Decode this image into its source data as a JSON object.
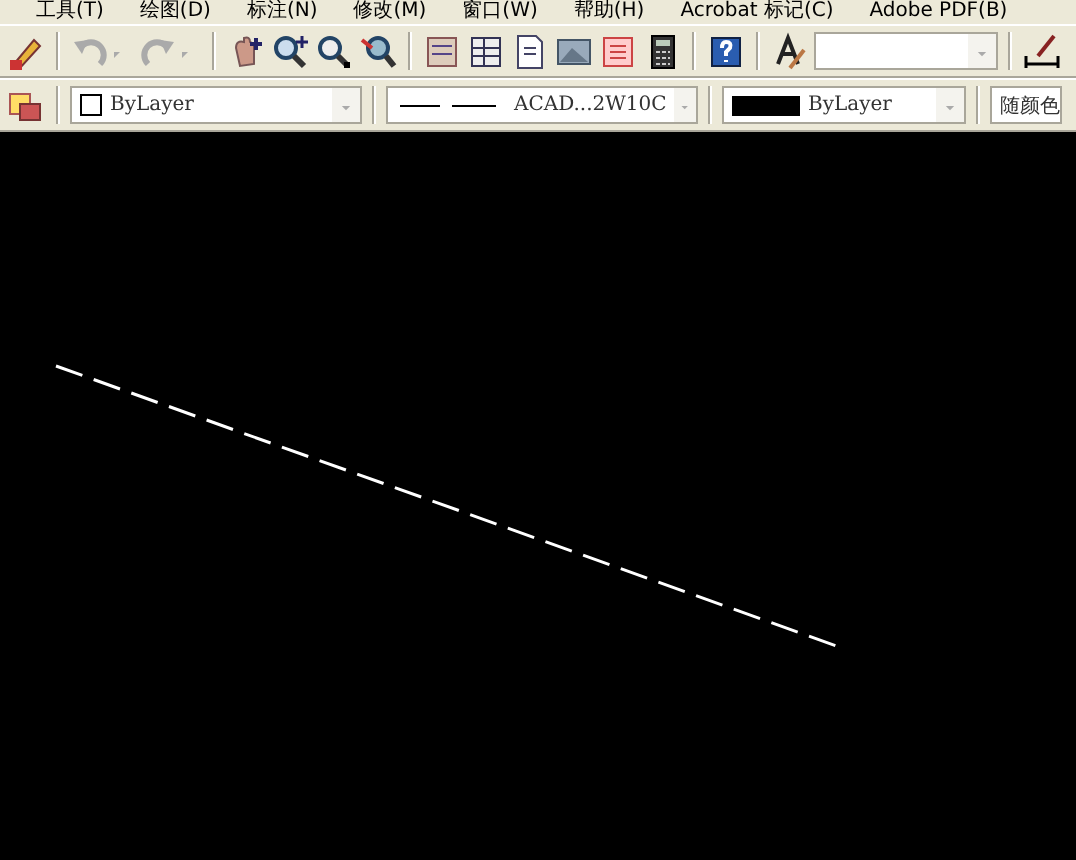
{
  "menu_bar": {
    "items": [
      "工具(T)",
      "绘图(D)",
      "标注(N)",
      "修改(M)",
      "窗口(W)",
      "帮助(H)",
      "Acrobat 标记(C)",
      "Adobe PDF(B)"
    ]
  },
  "standard_toolbar": {
    "buttons": [
      {
        "kind": "match"
      },
      {
        "kind": "sep"
      },
      {
        "kind": "undo",
        "disabled": true
      },
      {
        "kind": "caret",
        "disabled": true
      },
      {
        "kind": "redo",
        "disabled": true
      },
      {
        "kind": "caret",
        "disabled": true
      },
      {
        "kind": "sep"
      },
      {
        "kind": "pan"
      },
      {
        "kind": "zoom"
      },
      {
        "kind": "zoomwin"
      },
      {
        "kind": "zoomprev"
      },
      {
        "kind": "sep"
      },
      {
        "kind": "props"
      },
      {
        "kind": "grid"
      },
      {
        "kind": "doc"
      },
      {
        "kind": "photo"
      },
      {
        "kind": "sheet"
      },
      {
        "kind": "calc"
      },
      {
        "kind": "sep"
      },
      {
        "kind": "help"
      },
      {
        "kind": "sep"
      },
      {
        "kind": "textstyle"
      },
      {
        "kind": "combo"
      },
      {
        "kind": "sep"
      },
      {
        "kind": "dimstyle"
      }
    ]
  },
  "properties_toolbar": {
    "color_setting": "ByLayer",
    "linetype": "ACAD...2W10C",
    "lineweight": "ByLayer",
    "plot_style": "随颜色"
  }
}
